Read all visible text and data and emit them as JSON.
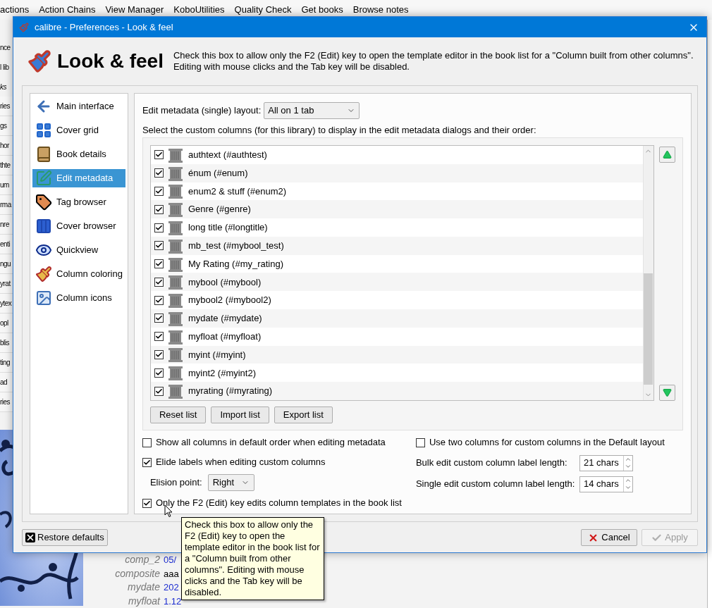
{
  "main_window": {
    "menu": [
      "actions",
      "Action Chains",
      "View Manager",
      "KoboUtilities",
      "Quality Check",
      "Get books",
      "Browse notes"
    ],
    "left_strip": {
      "toolbar": [
        "nce",
        "l lib"
      ],
      "header": "ks",
      "rows": [
        "ries",
        "gs",
        "hor",
        "thte",
        "um",
        "rma",
        "nre",
        "enti",
        "ngu",
        "yrat",
        "ytex",
        "opl",
        "blis",
        "ting",
        "ad",
        "ries"
      ]
    },
    "details": [
      {
        "label": "comp_2",
        "value": "05/",
        "color": "#1b2bd0"
      },
      {
        "label": "composite",
        "value": "aaa",
        "color": "#000000"
      },
      {
        "label": "mydate",
        "value": "202",
        "color": "#1b2bd0"
      },
      {
        "label": "myfloat",
        "value": "1.12",
        "color": "#1b2bd0"
      }
    ]
  },
  "dialog": {
    "title": "calibre - Preferences - Look & feel",
    "heading": "Look & feel",
    "description": "Check this box to allow only the F2 (Edit) key to open the template editor in the book list for a \"Column built from other columns\". Editing with mouse clicks and the Tab key will be disabled.",
    "sidebar": [
      {
        "label": "Main interface",
        "selected": false
      },
      {
        "label": "Cover grid",
        "selected": false
      },
      {
        "label": "Book details",
        "selected": false
      },
      {
        "label": "Edit metadata",
        "selected": true
      },
      {
        "label": "Tag browser",
        "selected": false
      },
      {
        "label": "Cover browser",
        "selected": false
      },
      {
        "label": "Quickview",
        "selected": false
      },
      {
        "label": "Column coloring",
        "selected": false
      },
      {
        "label": "Column icons",
        "selected": false
      }
    ],
    "layout": {
      "label": "Edit metadata (single) layout:",
      "value": "All on 1 tab"
    },
    "columns_label": "Select the custom columns (for this library) to display in the edit metadata dialogs and their order:",
    "columns": [
      {
        "label": "authtext (#authtest)",
        "checked": true
      },
      {
        "label": "énum (#enum)",
        "checked": true
      },
      {
        "label": "enum2 & stuff (#enum2)",
        "checked": true
      },
      {
        "label": "Genre (#genre)",
        "checked": true
      },
      {
        "label": "long title (#longtitle)",
        "checked": true
      },
      {
        "label": "mb_test (#mybool_test)",
        "checked": true
      },
      {
        "label": "My Rating (#my_rating)",
        "checked": true
      },
      {
        "label": "mybool (#mybool)",
        "checked": true
      },
      {
        "label": "mybool2 (#mybool2)",
        "checked": true
      },
      {
        "label": "mydate (#mydate)",
        "checked": true
      },
      {
        "label": "myfloat (#myfloat)",
        "checked": true
      },
      {
        "label": "myint (#myint)",
        "checked": true
      },
      {
        "label": "myint2 (#myint2)",
        "checked": true
      },
      {
        "label": "myrating (#myrating)",
        "checked": true
      }
    ],
    "list_buttons": [
      "Reset list",
      "Import list",
      "Export list"
    ],
    "left_options": [
      {
        "kind": "checkbox",
        "label": "Show all columns in default order when editing metadata",
        "checked": false
      },
      {
        "kind": "checkbox",
        "label": "Elide labels when editing custom columns",
        "checked": true
      },
      {
        "kind": "select",
        "label": "Elision point:",
        "value": "Right"
      },
      {
        "kind": "checkbox",
        "label": "Only the F2 (Edit) key edits column templates in the book list",
        "checked": true
      }
    ],
    "right_options": [
      {
        "kind": "checkbox",
        "label": "Use two columns for custom columns in the Default layout",
        "checked": false
      },
      {
        "kind": "spinbox",
        "label": "Bulk edit custom column label length:",
        "value": "21 chars"
      },
      {
        "kind": "spinbox",
        "label": "Single edit custom column label length:",
        "value": "14 chars"
      }
    ],
    "restore_button": "Restore defaults",
    "cancel_button": "Cancel",
    "apply_button": {
      "label": "Apply",
      "disabled": true
    }
  },
  "tooltip": "Check this box to allow only the F2 (Edit) key to open the template editor in the book list for a \"Column built from other columns\". Editing with mouse clicks and the Tab key will be disabled."
}
